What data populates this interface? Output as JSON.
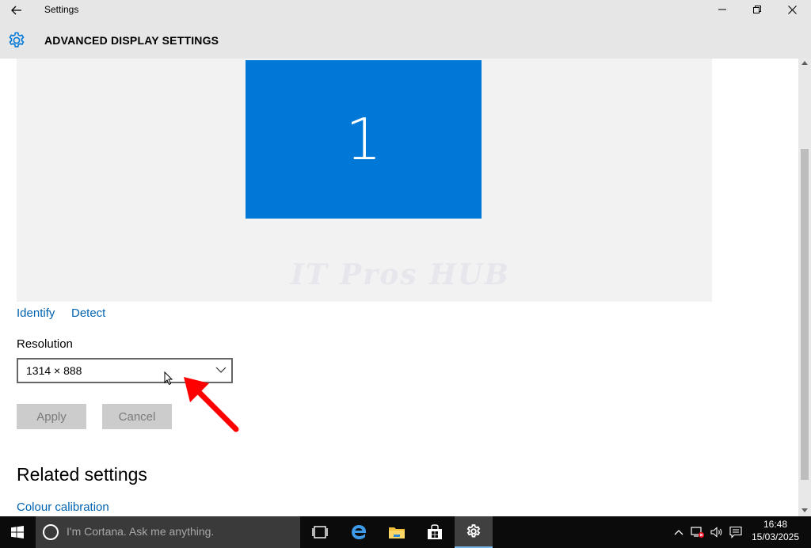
{
  "window": {
    "title": "Settings",
    "page_title": "ADVANCED DISPLAY SETTINGS"
  },
  "display": {
    "monitor_number": "1",
    "watermark": "IT Pros HUB",
    "identify_label": "Identify",
    "detect_label": "Detect"
  },
  "resolution": {
    "label": "Resolution",
    "selected_value": "1314 × 888"
  },
  "buttons": {
    "apply_label": "Apply",
    "cancel_label": "Cancel"
  },
  "related": {
    "heading": "Related settings",
    "colour_calibration_label": "Colour calibration"
  },
  "taskbar": {
    "cortana_placeholder": "I'm Cortana. Ask me anything.",
    "time": "16:48",
    "date": "15/03/2025"
  },
  "colors": {
    "accent": "#0078d7",
    "link": "#0063b1",
    "titlebar_bg": "#e6e6e6",
    "monitor_area_bg": "#f2f2f2",
    "taskbar_bg": "#0b0b0b",
    "annotation_arrow": "#ff0000"
  },
  "icons": {
    "back": "back-arrow-icon",
    "gear": "gear-icon",
    "start": "windows-logo-icon",
    "cortana": "cortana-circle-icon",
    "task_view": "task-view-icon",
    "edge": "edge-browser-icon",
    "explorer": "file-explorer-icon",
    "store": "store-icon",
    "settings": "settings-gear-icon"
  }
}
